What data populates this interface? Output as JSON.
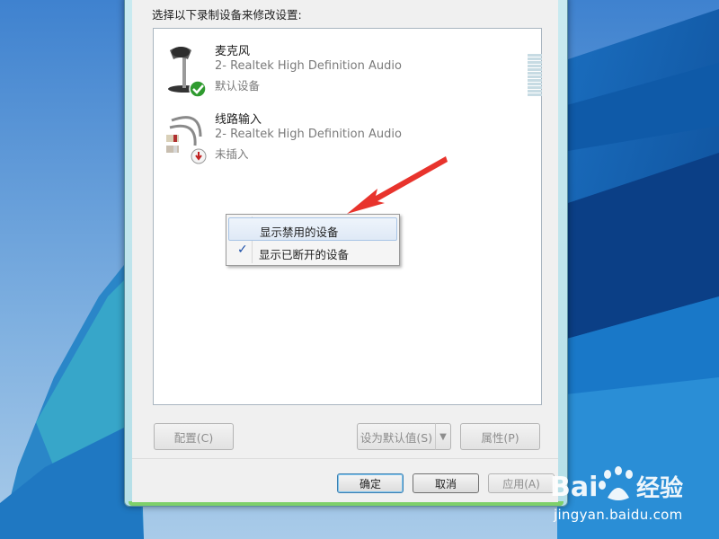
{
  "dialog": {
    "instruction": "选择以下录制设备来修改设置:"
  },
  "devices": [
    {
      "name": "麦克风",
      "driver": "2- Realtek High Definition Audio",
      "status": "默认设备",
      "icon": "microphone-icon",
      "badge": "default-check"
    },
    {
      "name": "线路输入",
      "driver": "2- Realtek High Definition Audio",
      "status": "未插入",
      "icon": "line-in-cable-icon",
      "badge": "unplugged-arrow"
    }
  ],
  "context_menu": {
    "items": [
      {
        "label": "显示禁用的设备",
        "checked": false,
        "highlighted": true
      },
      {
        "label": "显示已断开的设备",
        "checked": true,
        "highlighted": false
      }
    ],
    "check_glyph": "✓"
  },
  "panel_buttons": {
    "configure": "配置(C)",
    "set_default": "设为默认值(S)",
    "properties": "属性(P)"
  },
  "dialog_buttons": {
    "ok": "确定",
    "cancel": "取消",
    "apply": "应用(A)"
  },
  "watermark": {
    "logo_text": "Bai 经验",
    "url": "jingyan.baidu.com"
  },
  "colors": {
    "annotation_arrow": "#e8332c",
    "default_badge": "#2e9a2e",
    "accent": "#3c7fb1"
  }
}
